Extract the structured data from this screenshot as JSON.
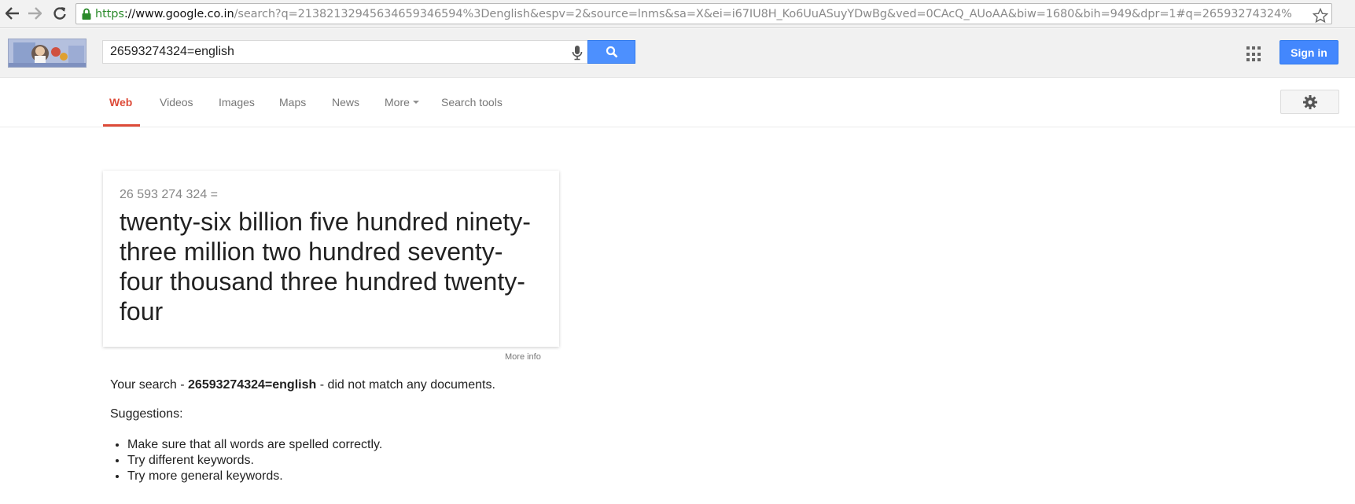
{
  "browser": {
    "url_scheme": "https",
    "url_separator": "://",
    "url_host": "www.google.co.in",
    "url_rest": "/search?q=21382132945634659346594%3Denglish&espv=2&source=lnms&sa=X&ei=i67IU8H_Ko6UuASuyYDwBg&ved=0CAcQ_AUoAA&biw=1680&bih=949&dpr=1#q=26593274324%"
  },
  "header": {
    "search_value": "26593274324=english",
    "signin_label": "Sign in"
  },
  "tabs": [
    {
      "label": "Web",
      "active": true
    },
    {
      "label": "Videos"
    },
    {
      "label": "Images"
    },
    {
      "label": "Maps"
    },
    {
      "label": "News"
    },
    {
      "label": "More"
    },
    {
      "label": "Search tools"
    }
  ],
  "result": {
    "number": "26 593 274 324 =",
    "words": "twenty-six billion five hundred ninety-three million two hundred seventy-four thousand three hundred twenty-four",
    "more_info": "More info"
  },
  "no_match": {
    "prefix": "Your search - ",
    "query": "26593274324=english",
    "suffix": " - did not match any documents."
  },
  "suggestions": {
    "title": "Suggestions:",
    "items": [
      "Make sure that all words are spelled correctly.",
      "Try different keywords.",
      "Try more general keywords."
    ]
  },
  "colors": {
    "accent_red": "#dd4b39",
    "search_blue": "#4d90fe",
    "signin_blue": "#4387fd"
  }
}
